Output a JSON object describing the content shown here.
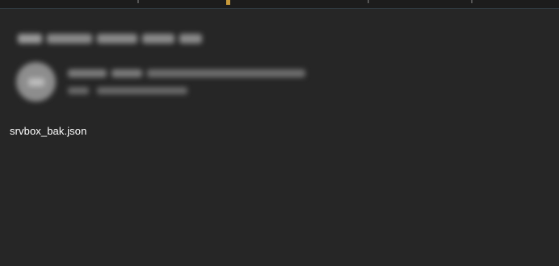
{
  "message": {
    "attachment": {
      "filename": "srvbox_bak.json"
    },
    "redacted": {
      "subject_icon": "blurred-text-icon",
      "avatar_icon": "blurred-avatar-icon"
    }
  }
}
